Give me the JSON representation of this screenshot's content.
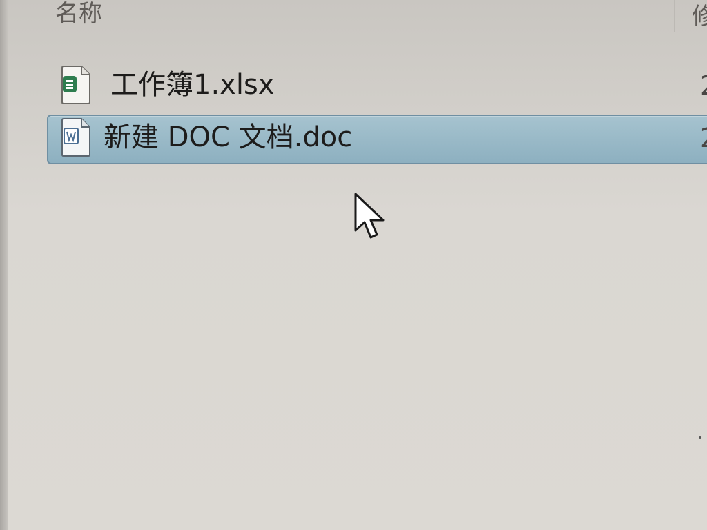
{
  "columns": {
    "name": "名称",
    "modified": "修"
  },
  "files": [
    {
      "name": "工作簿1.xlsx",
      "icon": "spreadsheet-icon",
      "date_fragment": "2",
      "selected": false
    },
    {
      "name": "新建 DOC 文档.doc",
      "icon": "document-icon",
      "date_fragment": "2",
      "selected": true
    }
  ],
  "colors": {
    "selection_fill": "#97b8c7",
    "selection_border": "#6f8fa2",
    "spreadsheet_accent": "#2e7d4f",
    "document_accent": "#4c6f93"
  }
}
